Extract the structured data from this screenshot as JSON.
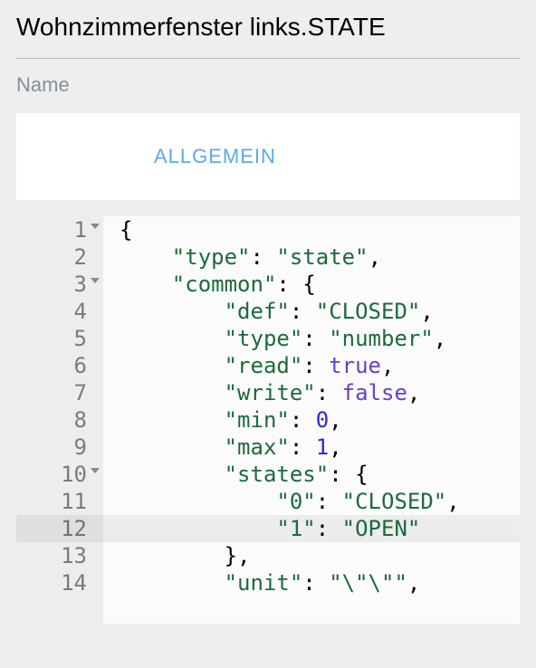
{
  "header": {
    "title": "Wohnzimmerfenster links.STATE",
    "name_label": "Name"
  },
  "tabs": {
    "active": "ALLGEMEIN"
  },
  "editor": {
    "highlighted_line": 12,
    "lines": [
      {
        "n": 1,
        "indent": 0,
        "fold": true,
        "parts": [
          {
            "t": "brace",
            "v": "{"
          }
        ]
      },
      {
        "n": 2,
        "indent": 1,
        "fold": false,
        "parts": [
          {
            "t": "key",
            "v": "\"type\""
          },
          {
            "t": "colon",
            "v": ": "
          },
          {
            "t": "str",
            "v": "\"state\""
          },
          {
            "t": "comma",
            "v": ","
          }
        ]
      },
      {
        "n": 3,
        "indent": 1,
        "fold": true,
        "parts": [
          {
            "t": "key",
            "v": "\"common\""
          },
          {
            "t": "colon",
            "v": ": "
          },
          {
            "t": "brace",
            "v": "{"
          }
        ]
      },
      {
        "n": 4,
        "indent": 2,
        "fold": false,
        "parts": [
          {
            "t": "key",
            "v": "\"def\""
          },
          {
            "t": "colon",
            "v": ": "
          },
          {
            "t": "str",
            "v": "\"CLOSED\""
          },
          {
            "t": "comma",
            "v": ","
          }
        ]
      },
      {
        "n": 5,
        "indent": 2,
        "fold": false,
        "parts": [
          {
            "t": "key",
            "v": "\"type\""
          },
          {
            "t": "colon",
            "v": ": "
          },
          {
            "t": "str",
            "v": "\"number\""
          },
          {
            "t": "comma",
            "v": ","
          }
        ]
      },
      {
        "n": 6,
        "indent": 2,
        "fold": false,
        "parts": [
          {
            "t": "key",
            "v": "\"read\""
          },
          {
            "t": "colon",
            "v": ": "
          },
          {
            "t": "true",
            "v": "true"
          },
          {
            "t": "comma",
            "v": ","
          }
        ]
      },
      {
        "n": 7,
        "indent": 2,
        "fold": false,
        "parts": [
          {
            "t": "key",
            "v": "\"write\""
          },
          {
            "t": "colon",
            "v": ": "
          },
          {
            "t": "false",
            "v": "false"
          },
          {
            "t": "comma",
            "v": ","
          }
        ]
      },
      {
        "n": 8,
        "indent": 2,
        "fold": false,
        "parts": [
          {
            "t": "key",
            "v": "\"min\""
          },
          {
            "t": "colon",
            "v": ": "
          },
          {
            "t": "num",
            "v": "0"
          },
          {
            "t": "comma",
            "v": ","
          }
        ]
      },
      {
        "n": 9,
        "indent": 2,
        "fold": false,
        "parts": [
          {
            "t": "key",
            "v": "\"max\""
          },
          {
            "t": "colon",
            "v": ": "
          },
          {
            "t": "num",
            "v": "1"
          },
          {
            "t": "comma",
            "v": ","
          }
        ]
      },
      {
        "n": 10,
        "indent": 2,
        "fold": true,
        "parts": [
          {
            "t": "key",
            "v": "\"states\""
          },
          {
            "t": "colon",
            "v": ": "
          },
          {
            "t": "brace",
            "v": "{"
          }
        ]
      },
      {
        "n": 11,
        "indent": 3,
        "fold": false,
        "parts": [
          {
            "t": "key",
            "v": "\"0\""
          },
          {
            "t": "colon",
            "v": ": "
          },
          {
            "t": "str",
            "v": "\"CLOSED\""
          },
          {
            "t": "comma",
            "v": ","
          }
        ]
      },
      {
        "n": 12,
        "indent": 3,
        "fold": false,
        "parts": [
          {
            "t": "key",
            "v": "\"1\""
          },
          {
            "t": "colon",
            "v": ": "
          },
          {
            "t": "str",
            "v": "\"OPEN\""
          }
        ]
      },
      {
        "n": 13,
        "indent": 2,
        "fold": false,
        "parts": [
          {
            "t": "brace",
            "v": "}"
          },
          {
            "t": "comma",
            "v": ","
          }
        ]
      },
      {
        "n": 14,
        "indent": 2,
        "fold": false,
        "parts": [
          {
            "t": "key",
            "v": "\"unit\""
          },
          {
            "t": "colon",
            "v": ": "
          },
          {
            "t": "str",
            "v": "\"\\\"\\\"\""
          },
          {
            "t": "comma",
            "v": ","
          }
        ]
      }
    ]
  }
}
